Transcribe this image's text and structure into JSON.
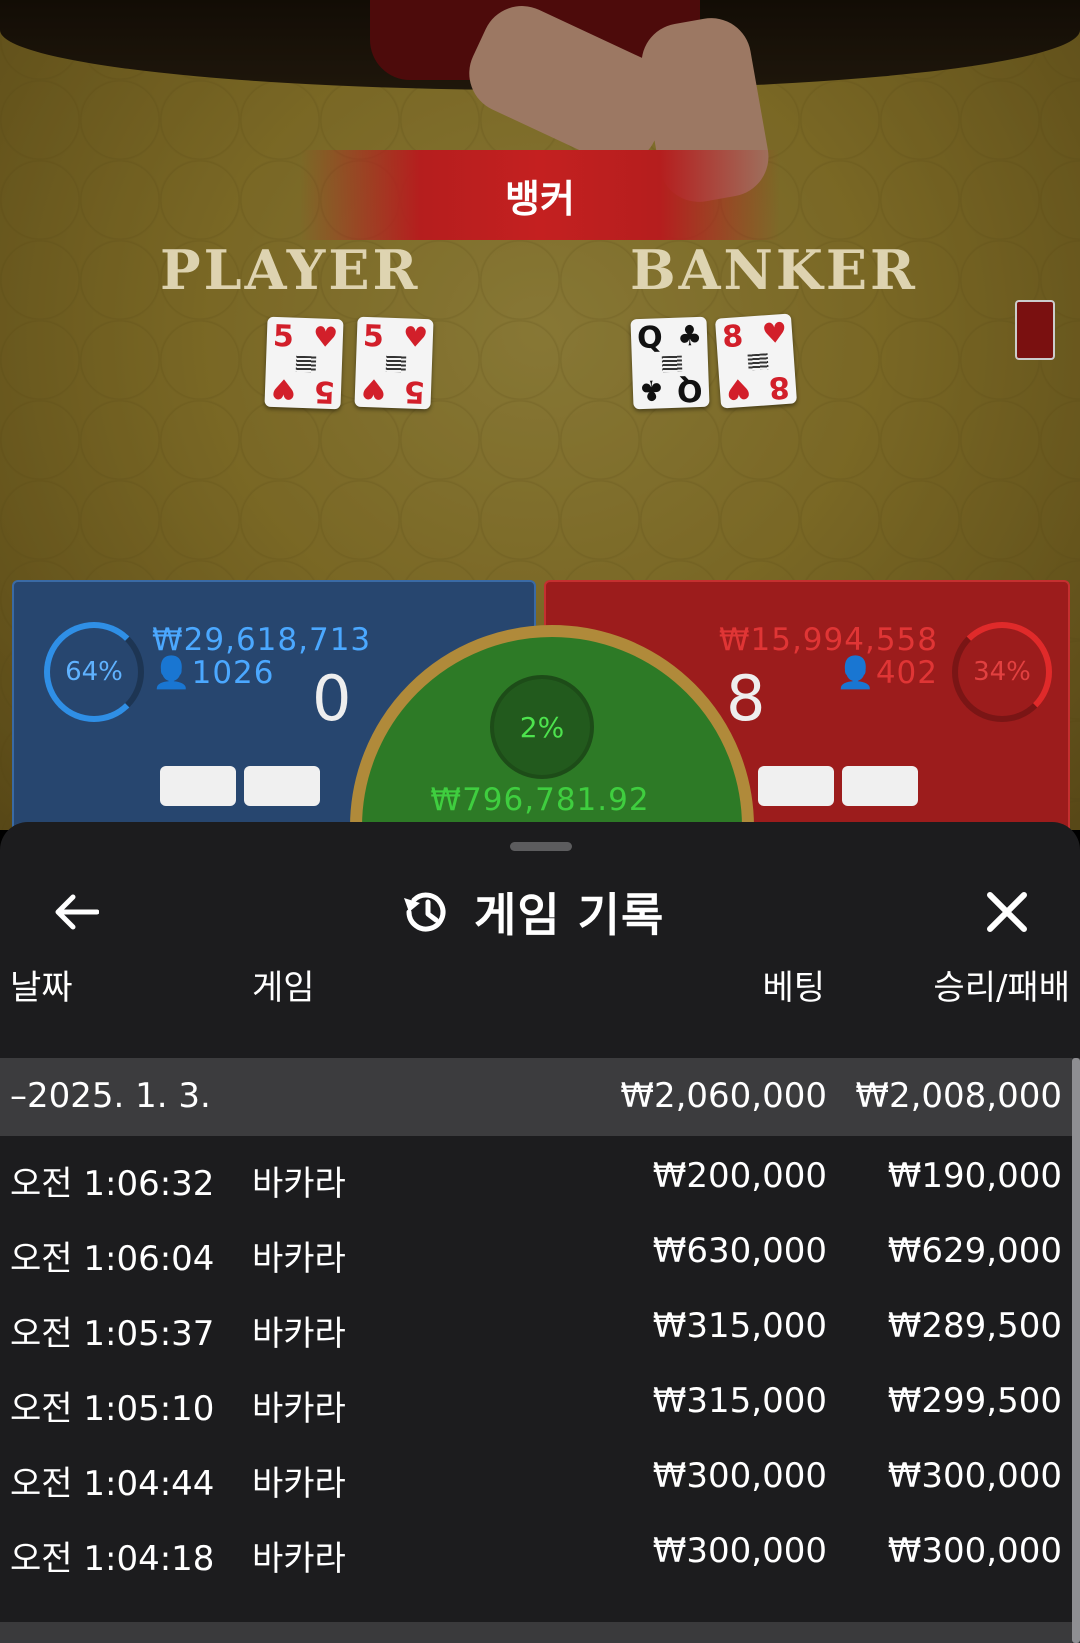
{
  "stage": {
    "result_banner": "뱅커",
    "player_label": "PLAYER",
    "banker_label": "BANKER",
    "player_cards": [
      {
        "rank": "5",
        "suit": "♥",
        "color": "red"
      },
      {
        "rank": "5",
        "suit": "♥",
        "color": "red"
      }
    ],
    "banker_cards": [
      {
        "rank": "Q",
        "suit": "♣",
        "color": "black"
      },
      {
        "rank": "8",
        "suit": "♥",
        "color": "red"
      }
    ]
  },
  "bets": {
    "player": {
      "percent": "64%",
      "amount": "₩29,618,713",
      "count": "1026",
      "score": "0",
      "color": "#2f8fe6"
    },
    "tie": {
      "percent": "2%",
      "amount": "₩796,781.92",
      "color": "#3fce3f"
    },
    "banker": {
      "percent": "34%",
      "amount": "₩15,994,558",
      "count": "402",
      "score": "8",
      "color": "#e02a2a"
    }
  },
  "sheet": {
    "title": "게임 기록",
    "icons": {
      "back": "arrow-left-icon",
      "history": "history-icon",
      "close": "close-icon"
    },
    "columns": {
      "date": "날짜",
      "game": "게임",
      "bet": "베팅",
      "result": "승리/패배"
    },
    "group": {
      "date": "–2025. 1. 3.",
      "bet": "₩2,060,000",
      "result": "₩2,008,000"
    },
    "rows": [
      {
        "time": "오전 1:06:32",
        "game": "바카라",
        "bet": "₩200,000",
        "result": "₩190,000"
      },
      {
        "time": "오전 1:06:04",
        "game": "바카라",
        "bet": "₩630,000",
        "result": "₩629,000"
      },
      {
        "time": "오전 1:05:37",
        "game": "바카라",
        "bet": "₩315,000",
        "result": "₩289,500"
      },
      {
        "time": "오전 1:05:10",
        "game": "바카라",
        "bet": "₩315,000",
        "result": "₩299,500"
      },
      {
        "time": "오전 1:04:44",
        "game": "바카라",
        "bet": "₩300,000",
        "result": "₩300,000"
      },
      {
        "time": "오전 1:04:18",
        "game": "바카라",
        "bet": "₩300,000",
        "result": "₩300,000"
      }
    ]
  }
}
